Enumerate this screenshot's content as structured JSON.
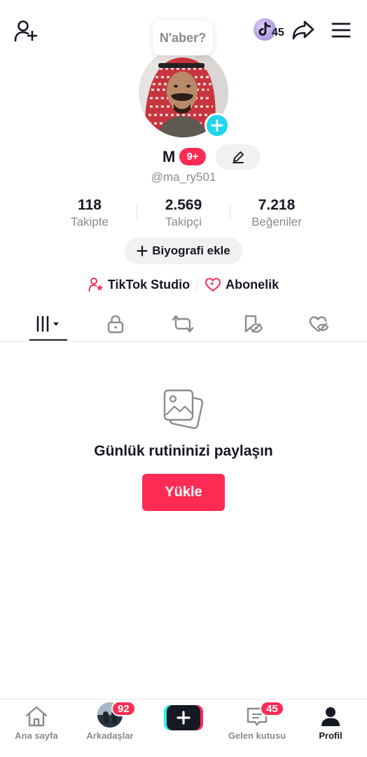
{
  "header": {
    "music_count": "45",
    "status_bubble": "N'aber?"
  },
  "profile": {
    "name": "M",
    "notification_badge": "9+",
    "username": "@ma_ry501"
  },
  "stats": [
    {
      "value": "118",
      "label": "Takipte"
    },
    {
      "value": "2.569",
      "label": "Takipçi"
    },
    {
      "value": "7.218",
      "label": "Beğeniler"
    }
  ],
  "bio_button": "Biyografi ekle",
  "links": {
    "studio": "TikTok Studio",
    "subscription": "Abonelik"
  },
  "empty_state": {
    "title": "Günlük rutininizi paylaşın",
    "upload_button": "Yükle"
  },
  "bottom_nav": {
    "home": "Ana sayfa",
    "friends": "Arkadaşlar",
    "friends_badge": "92",
    "inbox": "Gelen kutusu",
    "inbox_badge": "45",
    "profile": "Profil"
  },
  "colors": {
    "accent": "#fe2c55",
    "cyan": "#25f4ee",
    "add_blue": "#20d5ec",
    "text_primary": "#161823",
    "text_secondary": "#8a8b91"
  }
}
